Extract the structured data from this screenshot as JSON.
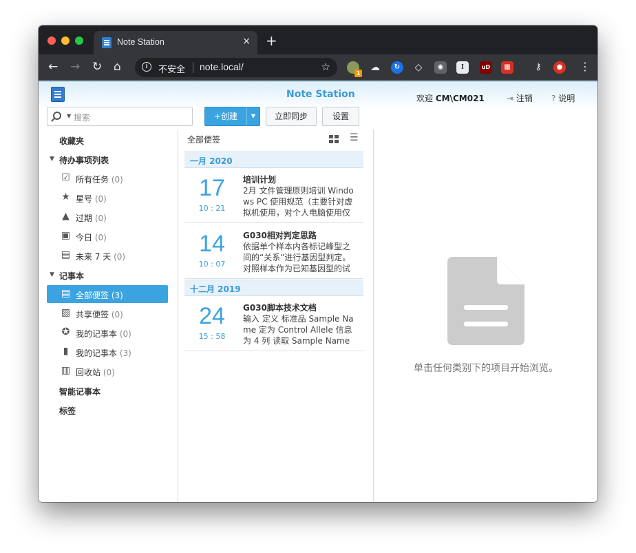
{
  "browser": {
    "tab_title": "Note Station",
    "close_glyph": "×",
    "new_tab_glyph": "+",
    "omnibox": {
      "security_label": "不安全",
      "url": "note.local/"
    },
    "extension_badge": "1"
  },
  "app": {
    "title": "Note Station",
    "welcome_prefix": "欢迎",
    "user": "CM\\CM021",
    "logout": "注销",
    "help": "说明",
    "search_placeholder": "搜索",
    "buttons": {
      "create": "创建",
      "sync": "立即同步",
      "settings": "设置"
    }
  },
  "sidebar": {
    "favorites": "收藏夹",
    "todo_section": "待办事项列表",
    "todo_items": [
      {
        "label": "所有任务",
        "count": "(0)",
        "icon": "checkbox-icon"
      },
      {
        "label": "星号",
        "count": "(0)",
        "icon": "star-icon"
      },
      {
        "label": "过期",
        "count": "(0)",
        "icon": "warning-icon"
      },
      {
        "label": "今日",
        "count": "(0)",
        "icon": "calendar-icon"
      },
      {
        "label": "未来 7 天",
        "count": "(0)",
        "icon": "calendar-week-icon"
      }
    ],
    "notebook_section": "记事本",
    "notebook_items": [
      {
        "label": "全部便签",
        "count": "(3)",
        "icon": "notes-icon",
        "active": true
      },
      {
        "label": "共享便签",
        "count": "(0)",
        "icon": "shared-notes-icon"
      },
      {
        "label": "我的记事本",
        "count": "(0)",
        "icon": "starred-notebook-icon"
      },
      {
        "label": "我的记事本",
        "count": "(3)",
        "icon": "notebook-icon"
      },
      {
        "label": "回收站",
        "count": "(0)",
        "icon": "trash-icon"
      }
    ],
    "smart_notebooks": "智能记事本",
    "tags": "标签"
  },
  "list": {
    "header": "全部便签",
    "groups": [
      {
        "month": "一月 2020",
        "notes": [
          {
            "day": "17",
            "time": "10 : 21",
            "title": "培训计划",
            "body": "2月 文件管理原则培训 Windows PC 使用规范（主要针对虚拟机使用，对个人电脑使用仅"
          },
          {
            "day": "14",
            "time": "10 : 07",
            "title": "G030相对判定思路",
            "body": "依据单个样本内各标记峰型之间的“关系”进行基因型判定。对照样本作为已知基因型的试"
          }
        ]
      },
      {
        "month": "十二月 2019",
        "notes": [
          {
            "day": "24",
            "time": "15 : 58",
            "title": "G030脚本技术文档",
            "body": "输入 定义 标准品 Sample Name 定为 Control Allele 信息为 4 列 读取 Sample Name"
          }
        ]
      }
    ]
  },
  "detail": {
    "empty_message": "单击任何类别下的项目开始浏览。"
  }
}
